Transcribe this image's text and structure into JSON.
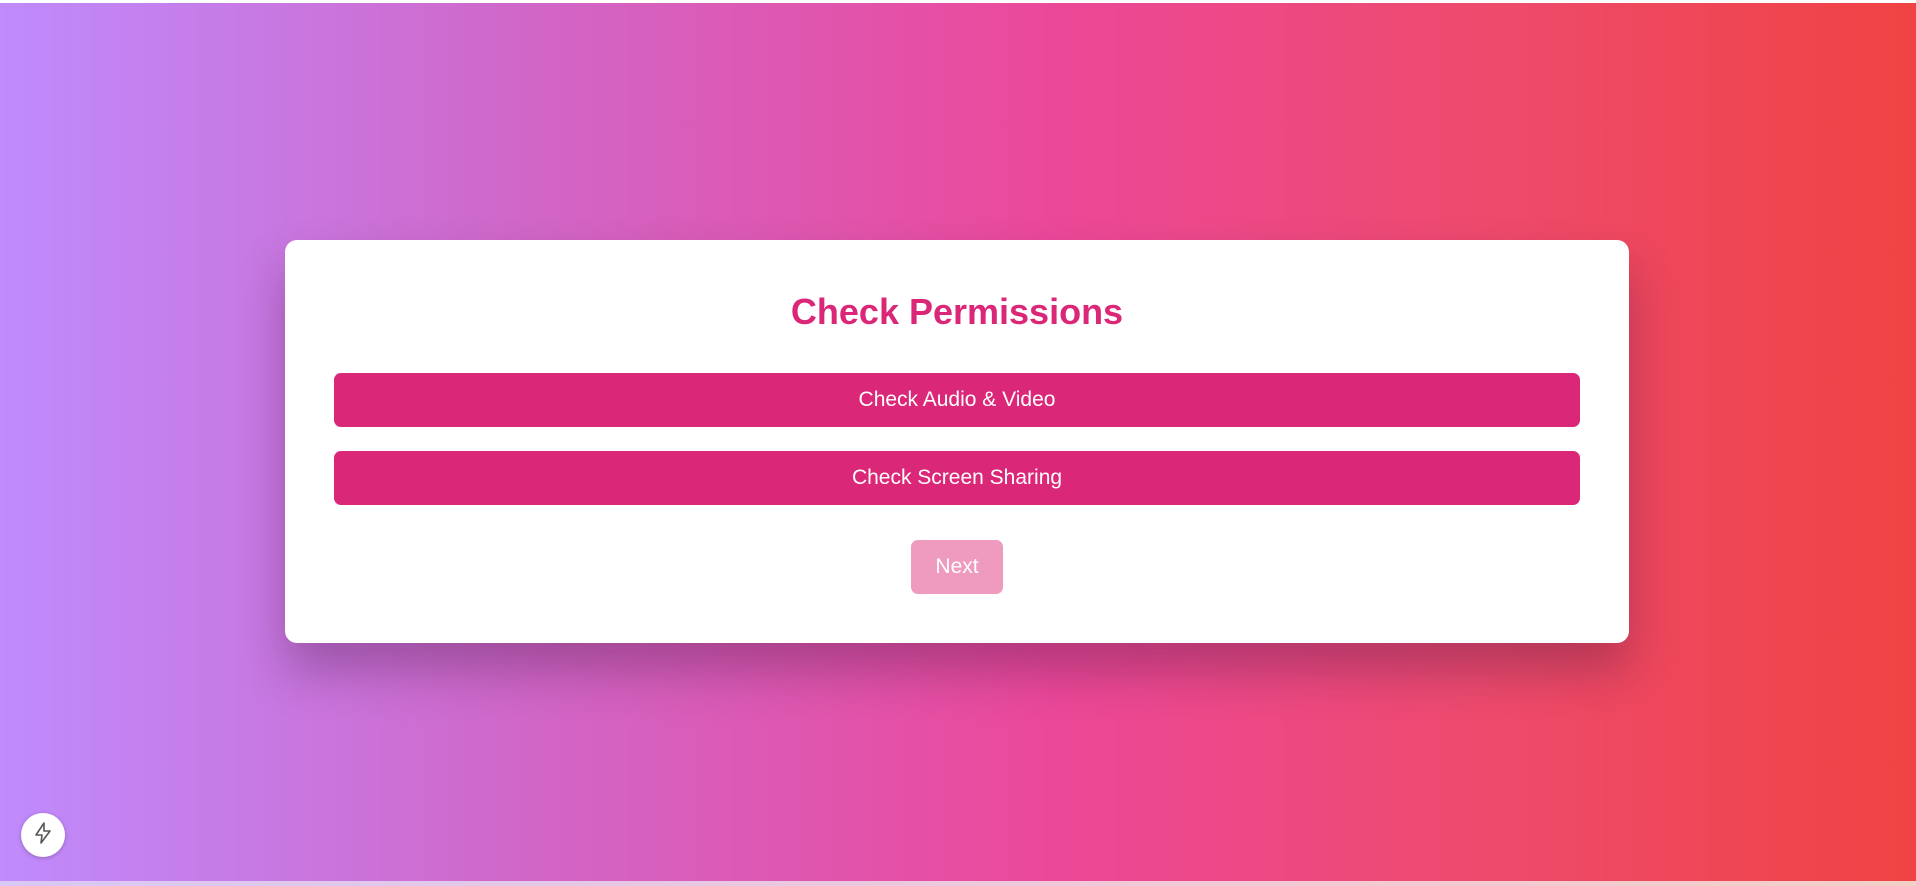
{
  "main": {
    "title": "Check Permissions",
    "audio_video_label": "Check Audio & Video",
    "screen_sharing_label": "Check Screen Sharing",
    "next_label": "Next",
    "next_enabled": false
  },
  "floating_action": {
    "icon": "lightning-bolt-icon"
  },
  "colors": {
    "accent": "#db2777",
    "next_disabled": "#ef9bbf",
    "gradient_start": "#bf8bfd",
    "gradient_mid": "#ec4899",
    "gradient_end": "#f04343"
  }
}
